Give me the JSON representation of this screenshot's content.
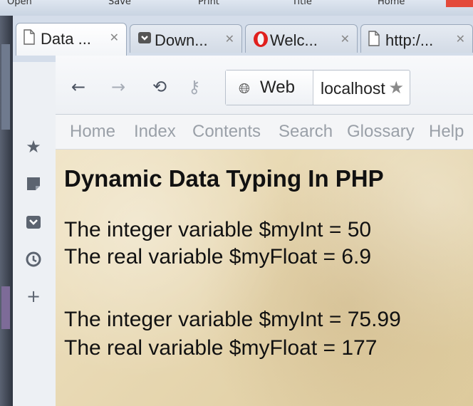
{
  "os_menu": {
    "items": [
      "Open",
      "Save",
      "Print",
      "Title",
      "Home"
    ]
  },
  "tabs": [
    {
      "title": "Data ...",
      "icon": "page-icon",
      "active": true
    },
    {
      "title": "Down...",
      "icon": "pocket-icon",
      "active": false
    },
    {
      "title": "Welc...",
      "icon": "opera-icon",
      "active": false
    },
    {
      "title": "http:/...",
      "icon": "page-icon",
      "active": false
    }
  ],
  "toolbar": {
    "search_engine": "Web",
    "url": "localhost"
  },
  "page_links": [
    "Home",
    "Index",
    "Contents",
    "Search",
    "Glossary",
    "Help"
  ],
  "sidebar": {
    "icons": [
      "star-icon",
      "note-icon",
      "pocket-icon",
      "history-icon",
      "add-icon"
    ]
  },
  "page": {
    "title": "Dynamic Data Typing In PHP",
    "lines": [
      "The integer variable $myInt = 50",
      "The real variable $myFloat = 6.9",
      "The integer variable $myInt = 75.99",
      "The real variable $myFloat = 177"
    ]
  },
  "colors": {
    "content_bg": "#e8d9b4",
    "chrome_bg": "#d4ddea",
    "link_gray": "#9aa0a8"
  }
}
